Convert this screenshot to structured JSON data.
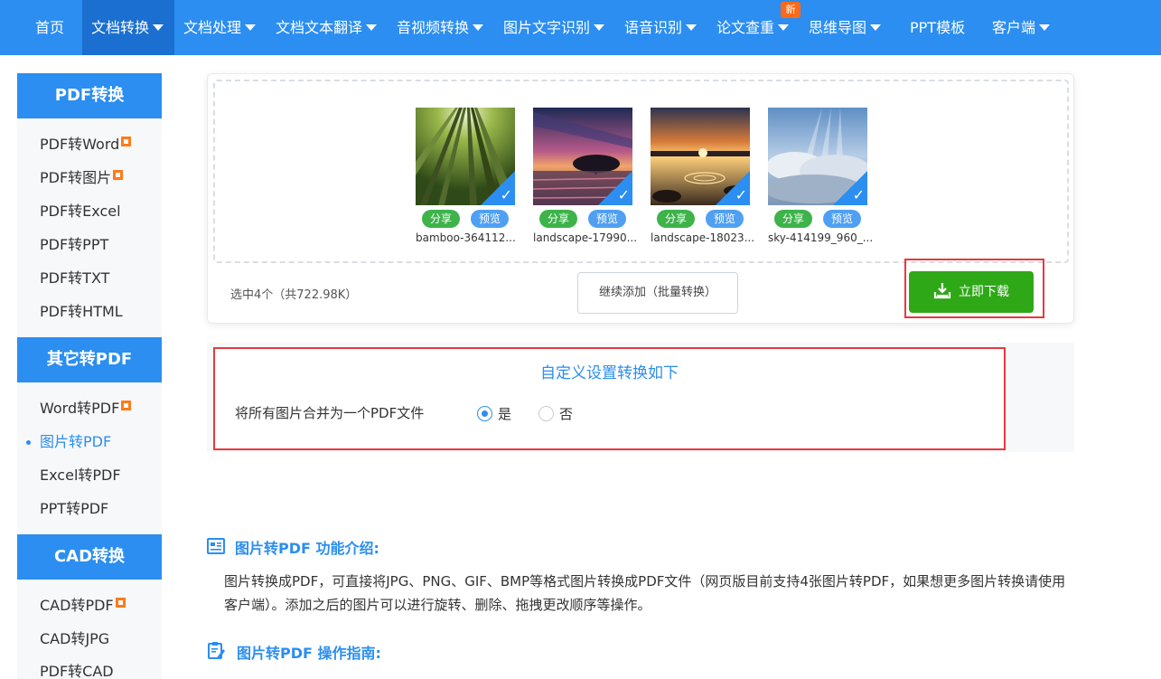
{
  "nav": {
    "items": [
      {
        "label": "首页",
        "caret": false
      },
      {
        "label": "文档转换",
        "caret": true
      },
      {
        "label": "文档处理",
        "caret": true
      },
      {
        "label": "文档文本翻译",
        "caret": true
      },
      {
        "label": "音视频转换",
        "caret": true
      },
      {
        "label": "图片文字识别",
        "caret": true
      },
      {
        "label": "语音识别",
        "caret": true
      },
      {
        "label": "论文查重",
        "caret": true
      },
      {
        "label": "思维导图",
        "caret": true
      },
      {
        "label": "PPT模板",
        "caret": false
      },
      {
        "label": "客户端",
        "caret": true
      }
    ],
    "active_index": 1,
    "new_badge": "新",
    "color": "#2b8ef0",
    "active_color": "#1a6fd0"
  },
  "sidebar": {
    "sections": [
      {
        "title": "PDF转换",
        "items": [
          {
            "label": "PDF转Word",
            "vip": true
          },
          {
            "label": "PDF转图片",
            "vip": true
          },
          {
            "label": "PDF转Excel",
            "vip": false
          },
          {
            "label": "PDF转PPT",
            "vip": false
          },
          {
            "label": "PDF转TXT",
            "vip": false
          },
          {
            "label": "PDF转HTML",
            "vip": false
          }
        ]
      },
      {
        "title": "其它转PDF",
        "items": [
          {
            "label": "Word转PDF",
            "vip": true
          },
          {
            "label": "图片转PDF",
            "vip": false,
            "active": true
          },
          {
            "label": "Excel转PDF",
            "vip": false
          },
          {
            "label": "PPT转PDF",
            "vip": false
          }
        ]
      },
      {
        "title": "CAD转换",
        "items": [
          {
            "label": "CAD转PDF",
            "vip": true
          },
          {
            "label": "CAD转JPG",
            "vip": false
          },
          {
            "label": "PDF转CAD",
            "vip": false
          }
        ]
      }
    ]
  },
  "upload": {
    "files": [
      {
        "name": "bamboo-364112...",
        "share": "分享",
        "preview": "预览",
        "selected": true,
        "image": "bamboo-forest"
      },
      {
        "name": "landscape-17990...",
        "share": "分享",
        "preview": "预览",
        "selected": true,
        "image": "sunset-tree"
      },
      {
        "name": "landscape-18023...",
        "share": "分享",
        "preview": "预览",
        "selected": true,
        "image": "sunset-lake"
      },
      {
        "name": "sky-414199_960_...",
        "share": "分享",
        "preview": "预览",
        "selected": true,
        "image": "clouds-sky"
      }
    ],
    "selected_info": "选中4个（共722.98K）",
    "add_more_label": "继续添加（批量转换）",
    "download_label": "立即下载",
    "download_color": "#2fa818"
  },
  "settings": {
    "title": "自定义设置转换如下",
    "merge_label": "将所有图片合并为一个PDF文件",
    "options": [
      {
        "label": "是",
        "checked": true
      },
      {
        "label": "否",
        "checked": false
      }
    ]
  },
  "intro": {
    "feature_title": "图片转PDF 功能介绍:",
    "feature_text": "图片转换成PDF，可直接将JPG、PNG、GIF、BMP等格式图片转换成PDF文件（网页版目前支持4张图片转PDF，如果想更多图片转换请使用客户端）。添加之后的图片可以进行旋转、删除、拖拽更改顺序等操作。",
    "guide_title": "图片转PDF 操作指南:"
  },
  "colors": {
    "accent": "#2b8ef0",
    "highlight_border": "#e8383d"
  }
}
